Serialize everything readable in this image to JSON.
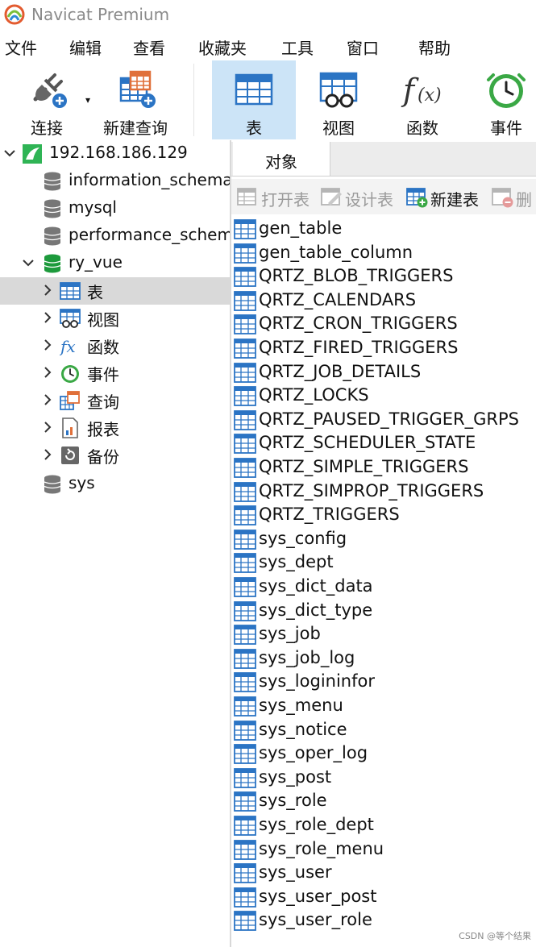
{
  "app": {
    "title": "Navicat Premium"
  },
  "menu": [
    "文件",
    "编辑",
    "查看",
    "收藏夹",
    "工具",
    "窗口",
    "帮助"
  ],
  "toolbar": {
    "connect": "连接",
    "new_query": "新建查询",
    "table": "表",
    "view": "视图",
    "function": "函数",
    "event": "事件"
  },
  "tree": {
    "connection": "192.168.186.129",
    "databases": {
      "information_schema": "information_schema",
      "mysql": "mysql",
      "performance_schema": "performance_schema",
      "ry_vue": "ry_vue",
      "sys": "sys"
    },
    "ry_vue_children": {
      "tables": "表",
      "views": "视图",
      "functions": "函数",
      "events": "事件",
      "queries": "查询",
      "reports": "报表",
      "backups": "备份"
    }
  },
  "tabs": {
    "objects": "对象"
  },
  "object_toolbar": {
    "open_table": "打开表",
    "design_table": "设计表",
    "new_table": "新建表",
    "delete_table": "删"
  },
  "tables": [
    "gen_table",
    "gen_table_column",
    "QRTZ_BLOB_TRIGGERS",
    "QRTZ_CALENDARS",
    "QRTZ_CRON_TRIGGERS",
    "QRTZ_FIRED_TRIGGERS",
    "QRTZ_JOB_DETAILS",
    "QRTZ_LOCKS",
    "QRTZ_PAUSED_TRIGGER_GRPS",
    "QRTZ_SCHEDULER_STATE",
    "QRTZ_SIMPLE_TRIGGERS",
    "QRTZ_SIMPROP_TRIGGERS",
    "QRTZ_TRIGGERS",
    "sys_config",
    "sys_dept",
    "sys_dict_data",
    "sys_dict_type",
    "sys_job",
    "sys_job_log",
    "sys_logininfor",
    "sys_menu",
    "sys_notice",
    "sys_oper_log",
    "sys_post",
    "sys_role",
    "sys_role_dept",
    "sys_role_menu",
    "sys_user",
    "sys_user_post",
    "sys_user_role"
  ],
  "watermark": "CSDN @等个结果",
  "colors": {
    "accent_blue": "#2b74c4",
    "selected_toolbar": "#cce4f7",
    "selected_tree": "#d9d9d9",
    "db_green": "#1d9a3c"
  }
}
